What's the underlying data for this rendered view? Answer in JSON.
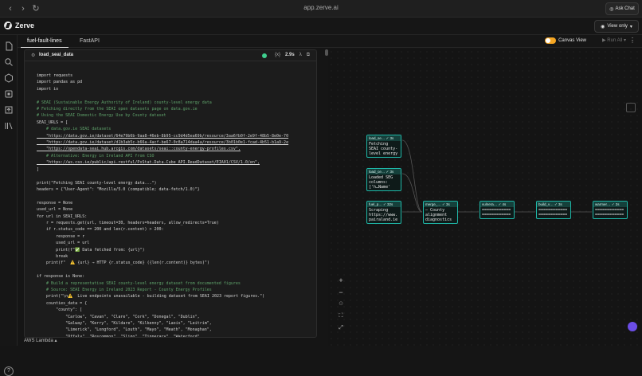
{
  "browser": {
    "url": "app.zerve.ai",
    "ask_chat": "Ask Chat"
  },
  "app": {
    "name": "Zerve",
    "view_mode": "View only"
  },
  "tabs": [
    {
      "label": "fuel-fault-lines"
    },
    {
      "label": "FastAPI"
    }
  ],
  "toolbar": {
    "canvas_view": "Canvas View",
    "run_all": "Run All"
  },
  "block": {
    "title": "load_seai_data",
    "duration": "2.9s",
    "brackets": "{x}",
    "lambda": "λ"
  },
  "code_lines": [
    {
      "t": "import requests",
      "c": "plain"
    },
    {
      "t": "import pandas as pd",
      "c": "plain"
    },
    {
      "t": "import io",
      "c": "plain"
    },
    {
      "t": "",
      "c": "plain"
    },
    {
      "t": "# SEAI (Sustainable Energy Authority of Ireland) county-level energy data",
      "c": "com"
    },
    {
      "t": "# Fetching directly from the SEAI open datasets page on data.gov.ie",
      "c": "com"
    },
    {
      "t": "# Using the SEAI Domestic Energy Use by County dataset",
      "c": "com"
    },
    {
      "t": "SEAI_URLS = [",
      "c": "plain"
    },
    {
      "t": "    # data.gov.ie SEAI datasets",
      "c": "com"
    },
    {
      "t": "    \"https://data.gov.ie/dataset/64e79b6b-9aa8-46eb-8b95-cc9d4d5ea69b/resource/3aa6fb0f-2e9f-48b5-8e0e-70",
      "c": "str"
    },
    {
      "t": "    \"https://data.gov.ie/dataset/d1b3ab5c-b66a-4acf-be67-0c8a714daa4a/resource/3b01b0e1-fcad-4b51-b1a9-2e",
      "c": "str"
    },
    {
      "t": "    \"https://opendata-seai.hub.arcgis.com/datasets/seai::county-energy-profiles.csv\",",
      "c": "str"
    },
    {
      "t": "    # Alternative: Energy in Ireland API from CSO",
      "c": "com"
    },
    {
      "t": "    \"https://ws.cso.ie/public/api.restful/PxStat.Data.Cube_API.ReadDataset/EIA01/CSV/1.0/en\",",
      "c": "str"
    },
    {
      "t": "]",
      "c": "plain"
    },
    {
      "t": "",
      "c": "plain"
    },
    {
      "t": "print(\"Fetching SEAI county-level energy data...\")",
      "c": "plain"
    },
    {
      "t": "headers = {\"User-Agent\": \"Mozilla/5.0 (compatible; data-fetch/1.0)\"}",
      "c": "plain"
    },
    {
      "t": "",
      "c": "plain"
    },
    {
      "t": "response = None",
      "c": "plain"
    },
    {
      "t": "used_url = None",
      "c": "plain"
    },
    {
      "t": "for url in SEAI_URLS:",
      "c": "plain"
    },
    {
      "t": "    r = requests.get(url, timeout=30, headers=headers, allow_redirects=True)",
      "c": "plain"
    },
    {
      "t": "    if r.status_code == 200 and len(r.content) > 200:",
      "c": "plain"
    },
    {
      "t": "        response = r",
      "c": "plain"
    },
    {
      "t": "        used_url = url",
      "c": "plain"
    },
    {
      "t": "        print(f\"✅ Data fetched from: {url}\")",
      "c": "plain"
    },
    {
      "t": "        break",
      "c": "plain"
    },
    {
      "t": "    print(f\"  ⚠️ {url} → HTTP {r.status_code} ({len(r.content)} bytes)\")",
      "c": "plain"
    },
    {
      "t": "",
      "c": "plain"
    },
    {
      "t": "if response is None:",
      "c": "plain"
    },
    {
      "t": "    # Build a representative SEAI county-level energy dataset from documented figures",
      "c": "com"
    },
    {
      "t": "    # Source: SEAI Energy in Ireland 2023 Report - County Energy Profiles",
      "c": "com"
    },
    {
      "t": "    print(\"\\n⚠️  Live endpoints unavailable - building dataset from SEAI 2023 report figures.\")",
      "c": "plain"
    },
    {
      "t": "    counties_data = {",
      "c": "plain"
    },
    {
      "t": "        \"county\": [",
      "c": "plain"
    },
    {
      "t": "            \"Carlow\", \"Cavan\", \"Clare\", \"Cork\", \"Donegal\", \"Dublin\",",
      "c": "plain"
    },
    {
      "t": "            \"Galway\", \"Kerry\", \"Kildare\", \"Kilkenny\", \"Laois\", \"Leitrim\",",
      "c": "plain"
    },
    {
      "t": "            \"Limerick\", \"Longford\", \"Louth\", \"Mayo\", \"Meath\", \"Monaghan\",",
      "c": "plain"
    },
    {
      "t": "            \"Offaly\", \"Roscommon\", \"Sligo\", \"Tipperary\", \"Waterford\",",
      "c": "plain"
    }
  ],
  "nodes": [
    {
      "head": "load_se… ✓ 3s",
      "body": "Fetching\nSEAI county-\nlevel energy"
    },
    {
      "head": "load_ce… ✓ 3s",
      "body": "Loaded SEG\ncolumns:\n['h…Name'"
    },
    {
      "head": "fuel_p… ✓ 32s",
      "body": "Scraping\nhttps://www.\npairaland.ie"
    },
    {
      "head": "merge_… ✓ 3s",
      "body": "— County\nalignment\ndiagnostics"
    },
    {
      "head": "vulnera… ✓ 4s",
      "body": "============\n============"
    },
    {
      "head": "build_v… ✓ 3s",
      "body": "============\n============"
    },
    {
      "head": "warmer… ✓ 2s",
      "body": "============\n============"
    }
  ],
  "zoom": {
    "in": "+",
    "out": "−"
  },
  "footer": {
    "env": "AWS Lambda"
  },
  "colors": {
    "node_border": "#1fb8a8",
    "status": "#3ecf8e",
    "toggle": "#f5a623"
  }
}
